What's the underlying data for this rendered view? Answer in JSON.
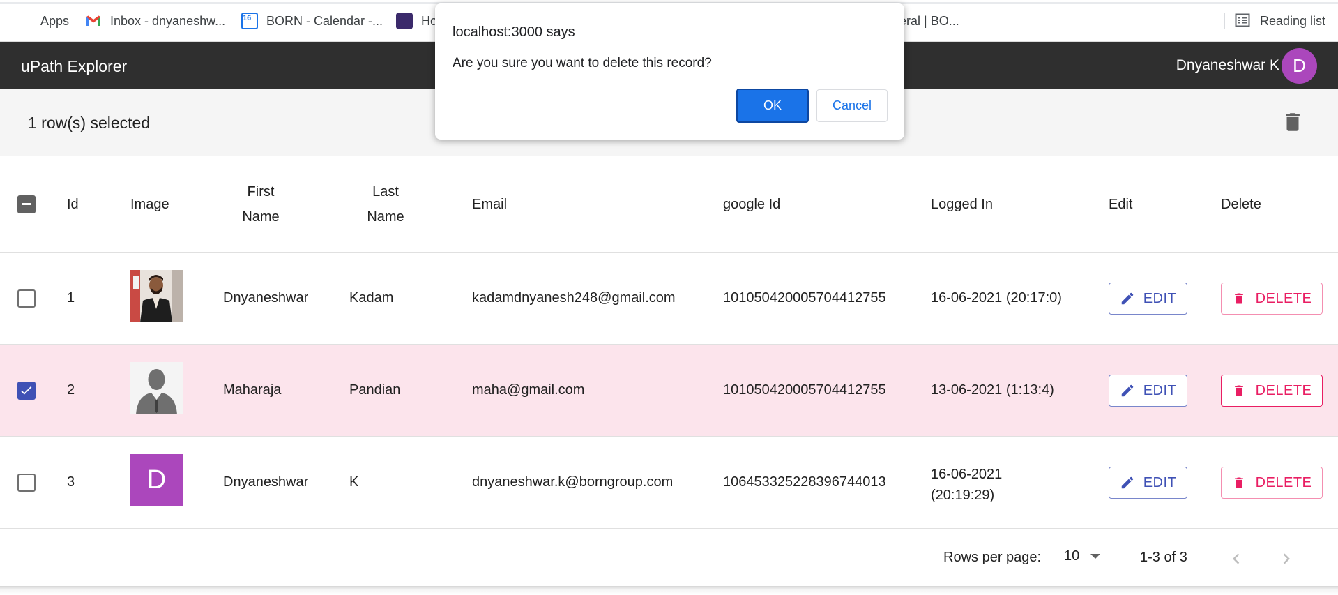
{
  "bookmarks": {
    "apps": "Apps",
    "inbox": "Inbox - dnyaneshw...",
    "calendar": "BORN - Calendar -...",
    "calendar_day": "16",
    "partial_home": "Ho",
    "partial_general": "eral | BO...",
    "reading_list": "Reading list"
  },
  "appbar": {
    "title": "uPath Explorer",
    "user_name": "Dnyaneshwar K",
    "avatar_letter": "D",
    "avatar_color": "#ab47bc"
  },
  "toolbar": {
    "selected_text": "1 row(s) selected"
  },
  "table": {
    "headers": {
      "id": "Id",
      "image": "Image",
      "first_name_1": "First",
      "first_name_2": "Name",
      "last_name_1": "Last",
      "last_name_2": "Name",
      "email": "Email",
      "google_id": "google Id",
      "logged_in": "Logged In",
      "edit": "Edit",
      "delete": "Delete"
    },
    "edit_label": "EDIT",
    "delete_label": "DELETE",
    "rows": [
      {
        "id": "1",
        "first_name": "Dnyaneshwar",
        "last_name": "Kadam",
        "email": "kadamdnyanesh248@gmail.com",
        "google_id": "101050420005704412755",
        "logged_in_1": "16-06-2021 (20:17:0)",
        "logged_in_2": "",
        "image": "photo",
        "checked": false
      },
      {
        "id": "2",
        "first_name": "Maharaja",
        "last_name": "Pandian",
        "email": "maha@gmail.com",
        "google_id": "101050420005704412755",
        "logged_in_1": "13-06-2021 (1:13:4)",
        "logged_in_2": "",
        "image": "placeholder-silhouette",
        "checked": true
      },
      {
        "id": "3",
        "first_name": "Dnyaneshwar",
        "last_name": "K",
        "email": "dnyaneshwar.k@borngroup.com",
        "google_id": "106453325228396744013",
        "logged_in_1": "16-06-2021",
        "logged_in_2": "(20:19:29)",
        "image": "letter-avatar",
        "image_letter": "D",
        "checked": false
      }
    ]
  },
  "pagination": {
    "rows_per_page_label": "Rows per page:",
    "rows_per_page_value": "10",
    "range": "1-3 of 3"
  },
  "dialog": {
    "title": "localhost:3000 says",
    "message": "Are you sure you want to delete this record?",
    "ok": "OK",
    "cancel": "Cancel"
  },
  "colors": {
    "appbar_bg": "#2f2f2f",
    "selected_row_bg": "#fce4ec",
    "primary": "#3f51b5",
    "secondary": "#e91e63",
    "dialog_ok": "#1a73e8"
  }
}
